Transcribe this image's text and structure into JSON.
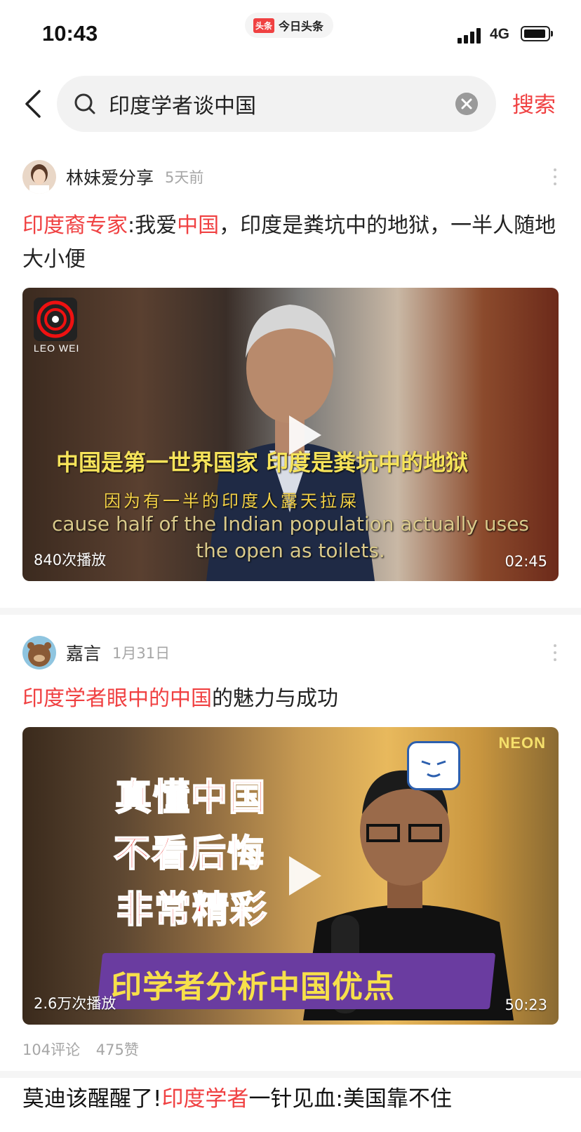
{
  "status_bar": {
    "time": "10:43",
    "app_logo": "头条",
    "app_name": "今日头条",
    "network": "4G"
  },
  "search": {
    "query": "印度学者谈中国",
    "button_label": "搜索"
  },
  "feed": [
    {
      "author": "林妹爱分享",
      "date": "5天前",
      "title_parts": [
        {
          "text": "印度裔专家",
          "highlight": true
        },
        {
          "text": ":我爱",
          "highlight": false
        },
        {
          "text": "中国",
          "highlight": true
        },
        {
          "text": "，印度是粪坑中的地狱，一半人随地大小便",
          "highlight": false
        }
      ],
      "video": {
        "channel_logo": "LEO WEI",
        "subtitle_cn_main": "中国是第一世界国家  印度是粪坑中的地狱",
        "subtitle_cn_secondary": "因为有一半的印度人露天拉屎",
        "subtitle_en_line1": "cause half of the Indian population actually uses",
        "subtitle_en_line2": "the open as toilets.",
        "views": "840次播放",
        "duration": "02:45"
      }
    },
    {
      "author": "嘉言",
      "date": "1月31日",
      "title_parts": [
        {
          "text": "印度学者眼中的中国",
          "highlight": true
        },
        {
          "text": "的魅力与成功",
          "highlight": false
        }
      ],
      "video": {
        "overlay_line1": "真懂中国",
        "overlay_line2": "不看后悔",
        "overlay_line3": "非常精彩",
        "banner": "印学者分析中国优点",
        "watermark": "NEON",
        "views": "2.6万次播放",
        "duration": "50:23"
      },
      "comments": "104评论",
      "likes": "475赞"
    },
    {
      "title_parts": [
        {
          "text": "莫迪该醒醒了!",
          "highlight": false
        },
        {
          "text": "印度学者",
          "highlight": true
        },
        {
          "text": "一针见血:美国靠不住",
          "highlight": false
        }
      ]
    }
  ]
}
